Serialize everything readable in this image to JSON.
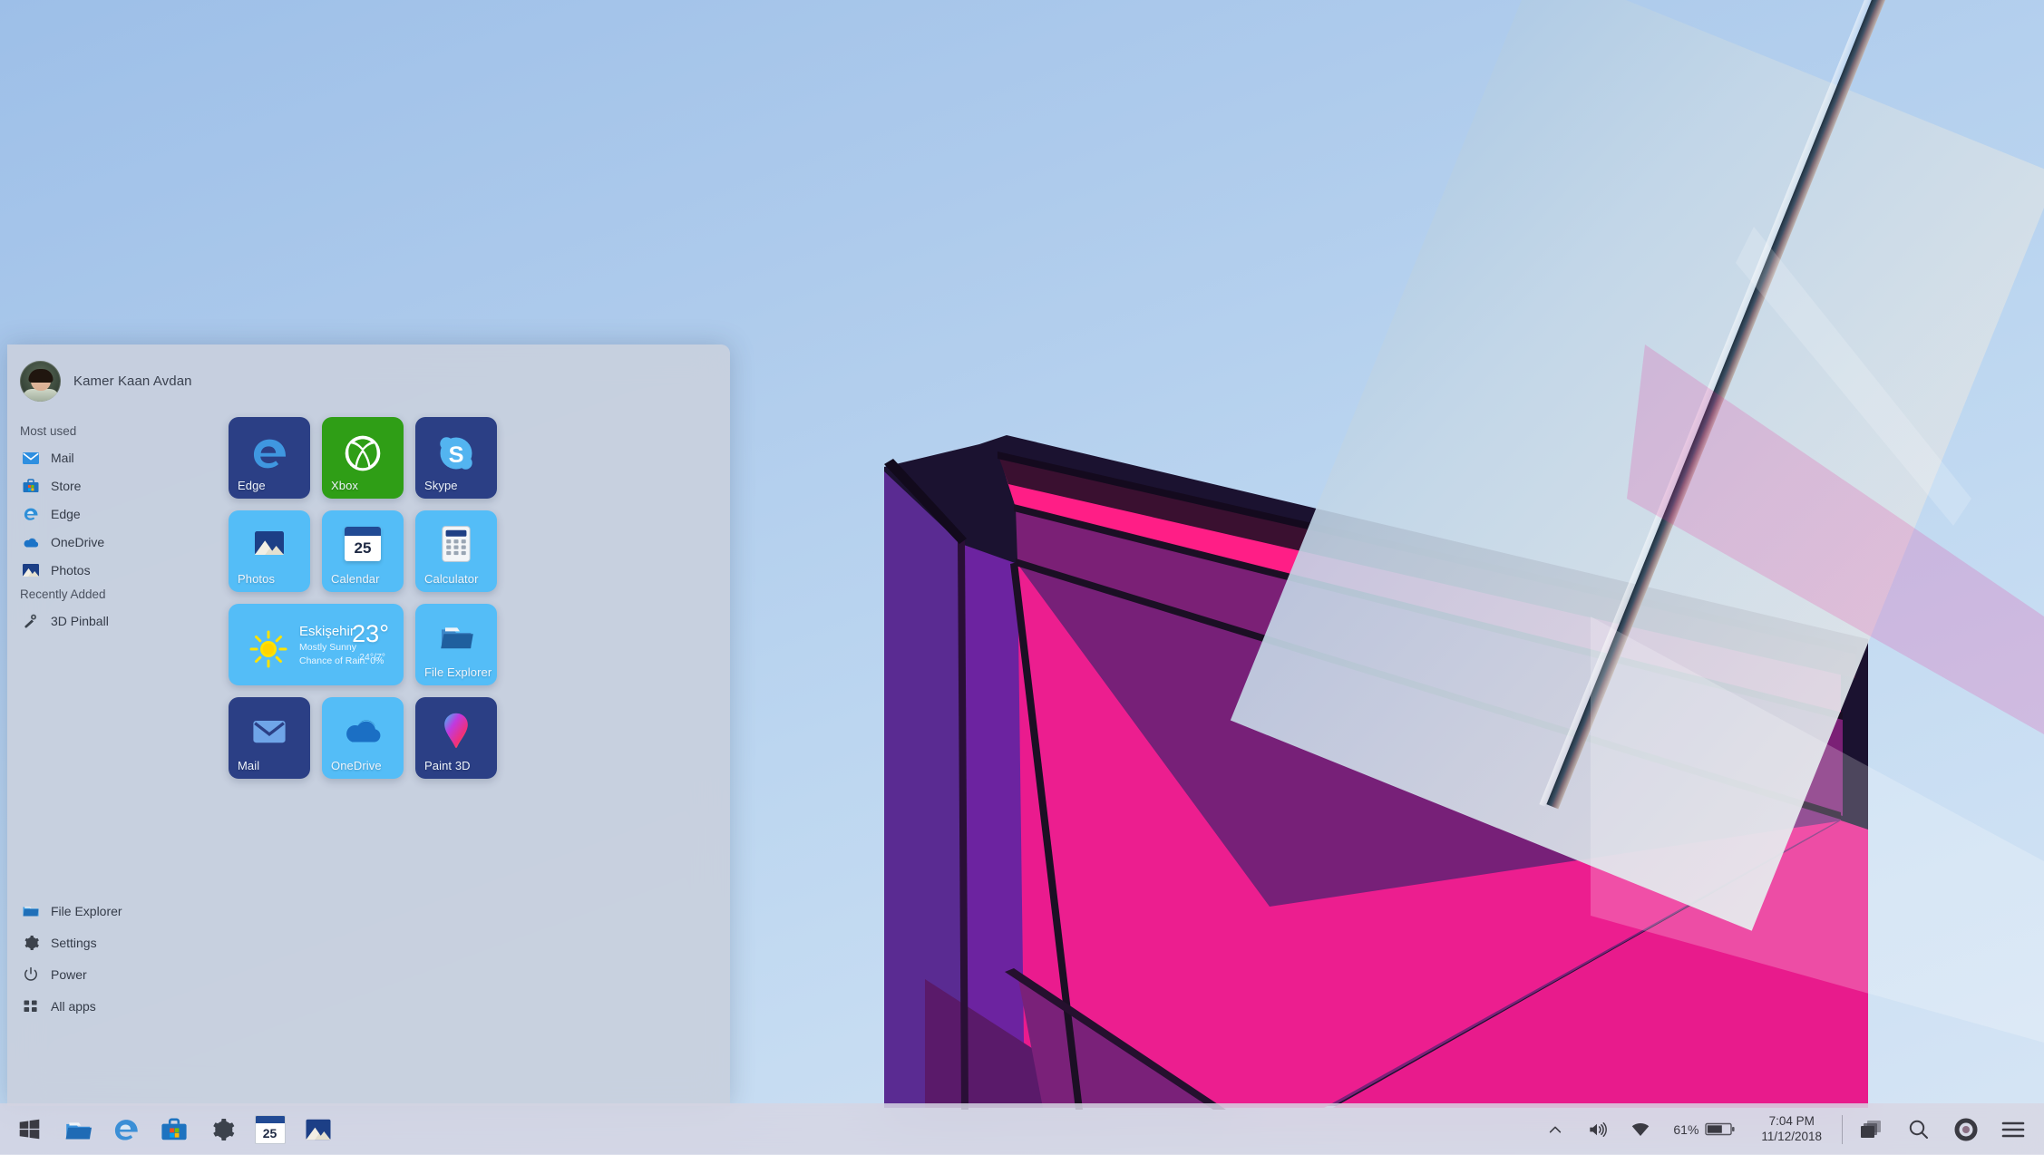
{
  "desktop": {
    "wallpaper_name": "geometric-magenta-building-wallpaper",
    "sky_color": "#b4d0ee",
    "accent_colors": [
      "#ec1e8f",
      "#7b2483",
      "#5b2a8f",
      "#c2d9ee"
    ]
  },
  "start_menu": {
    "user": {
      "name": "Kamer Kaan Avdan",
      "avatar_name": "user-avatar"
    },
    "sections": [
      {
        "label": "Most used"
      },
      {
        "label": "Recently Added"
      }
    ],
    "most_used": [
      {
        "label": "Mail",
        "icon": "mail-icon"
      },
      {
        "label": "Store",
        "icon": "store-icon"
      },
      {
        "label": "Edge",
        "icon": "edge-icon"
      },
      {
        "label": "OneDrive",
        "icon": "onedrive-icon"
      },
      {
        "label": "Photos",
        "icon": "photos-icon"
      }
    ],
    "recently_added": [
      {
        "label": "3D Pinball",
        "icon": "pinball-icon"
      }
    ],
    "bottom_items": [
      {
        "label": "File Explorer",
        "icon": "folder-icon"
      },
      {
        "label": "Settings",
        "icon": "gear-icon"
      },
      {
        "label": "Power",
        "icon": "power-icon"
      },
      {
        "label": "All apps",
        "icon": "grid-icon"
      }
    ],
    "tiles": [
      {
        "label": "Edge",
        "icon": "edge-icon",
        "style": "tile-dark"
      },
      {
        "label": "Xbox",
        "icon": "xbox-icon",
        "style": "tile-green"
      },
      {
        "label": "Skype",
        "icon": "skype-icon",
        "style": "tile-dark"
      },
      {
        "label": "Photos",
        "icon": "photos-icon",
        "style": "tile-light"
      },
      {
        "label": "Calendar",
        "icon": "calendar-icon",
        "style": "tile-light"
      },
      {
        "label": "Calculator",
        "icon": "calculator-icon",
        "style": "tile-light"
      },
      {
        "label": "File Explorer",
        "icon": "folder-icon",
        "style": "tile-light"
      },
      {
        "label": "Mail",
        "icon": "mail-icon",
        "style": "tile-dark"
      },
      {
        "label": "OneDrive",
        "icon": "onedrive-icon",
        "style": "tile-light"
      },
      {
        "label": "Paint 3D",
        "icon": "paint3d-icon",
        "style": "tile-dark"
      }
    ],
    "weather_tile": {
      "city": "Eskişehir",
      "condition": "Mostly Sunny",
      "rain": "Chance of Rain: 0%",
      "temp": "23°",
      "high_low": "24°/7°",
      "icon": "sun-icon"
    },
    "calendar_tile_day": "25"
  },
  "taskbar": {
    "pinned": [
      {
        "name": "start-button",
        "icon": "windows-logo-icon"
      },
      {
        "name": "file-explorer",
        "icon": "folder-icon"
      },
      {
        "name": "edge",
        "icon": "edge-icon"
      },
      {
        "name": "store",
        "icon": "store-icon"
      },
      {
        "name": "settings",
        "icon": "gear-icon"
      },
      {
        "name": "calendar",
        "icon": "calendar-icon",
        "day": "25"
      },
      {
        "name": "photos",
        "icon": "photos-icon"
      }
    ],
    "tray": {
      "show_hidden_icons": "show-hidden-icons-chevron",
      "volume": "volume-icon",
      "wifi": "wifi-icon",
      "battery_percent": "61%",
      "battery_icon": "battery-icon",
      "time": "7:04 PM",
      "date": "11/12/2018",
      "task_view": "task-view-icon",
      "search": "search-icon",
      "cortana": "cortana-icon",
      "action_center": "action-center-icon"
    }
  }
}
